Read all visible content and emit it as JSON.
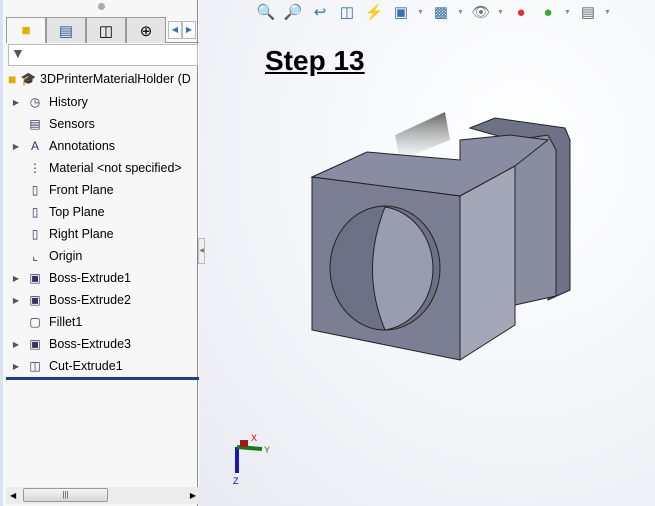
{
  "feature_tree": {
    "tabs": [
      "feature-manager",
      "property-manager",
      "configuration-manager",
      "dimxpert-manager"
    ],
    "root": "3DPrinterMaterialHolder  (D",
    "items": [
      {
        "label": "History",
        "expandable": true,
        "icon": "history-icon"
      },
      {
        "label": "Sensors",
        "expandable": false,
        "icon": "sensors-icon"
      },
      {
        "label": "Annotations",
        "expandable": true,
        "icon": "annotations-icon"
      },
      {
        "label": "Material <not specified>",
        "expandable": false,
        "icon": "material-icon"
      },
      {
        "label": "Front Plane",
        "expandable": false,
        "icon": "plane-icon"
      },
      {
        "label": "Top Plane",
        "expandable": false,
        "icon": "plane-icon"
      },
      {
        "label": "Right Plane",
        "expandable": false,
        "icon": "plane-icon"
      },
      {
        "label": "Origin",
        "expandable": false,
        "icon": "origin-icon"
      },
      {
        "label": "Boss-Extrude1",
        "expandable": true,
        "icon": "extrude-icon"
      },
      {
        "label": "Boss-Extrude2",
        "expandable": true,
        "icon": "extrude-icon"
      },
      {
        "label": "Fillet1",
        "expandable": false,
        "icon": "fillet-icon"
      },
      {
        "label": "Boss-Extrude3",
        "expandable": true,
        "icon": "extrude-icon"
      },
      {
        "label": "Cut-Extrude1",
        "expandable": true,
        "icon": "cut-extrude-icon"
      }
    ]
  },
  "viewport": {
    "title": "Step 13",
    "toolbar": [
      "zoom-to-fit",
      "zoom-to-area",
      "previous-view",
      "section-view",
      "dynamic-annotation-view",
      "view-orientation",
      "display-style",
      "hide-show-items",
      "edit-appearance",
      "apply-scene",
      "view-settings"
    ],
    "triad": {
      "x": "X",
      "y": "Y",
      "z": "Z"
    },
    "model_color": "#7c7f93"
  }
}
